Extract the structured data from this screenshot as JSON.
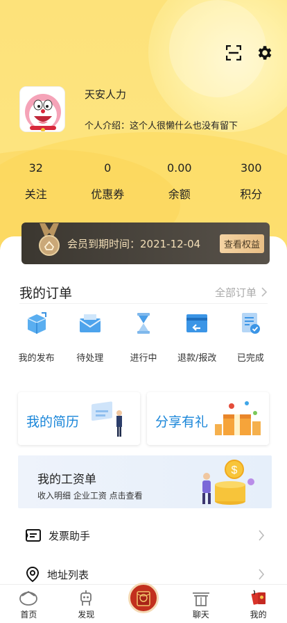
{
  "header": {
    "username": "天安人力",
    "intro": "个人介绍：这个人很懒什么也没有留下"
  },
  "stats": [
    {
      "value": "32",
      "label": "关注"
    },
    {
      "value": "0",
      "label": "优惠券"
    },
    {
      "value": "0.00",
      "label": "余额"
    },
    {
      "value": "300",
      "label": "积分"
    }
  ],
  "vip": {
    "expire_text": "会员到期时间：2021-12-04",
    "button_label": "查看权益"
  },
  "orders": {
    "title": "我的订单",
    "all_label": "全部订单",
    "items": [
      {
        "label": "我的发布",
        "icon": "publish-box-icon"
      },
      {
        "label": "待处理",
        "icon": "mail-icon"
      },
      {
        "label": "进行中",
        "icon": "hourglass-icon"
      },
      {
        "label": "退款/报改",
        "icon": "refund-icon"
      },
      {
        "label": "已完成",
        "icon": "done-doc-icon"
      }
    ]
  },
  "cards": {
    "resume": "我的简历",
    "share": "分享有礼"
  },
  "salary": {
    "title": "我的工资单",
    "subtitle": "收入明细 企业工资 点击查看"
  },
  "menu": {
    "invoice": "发票助手",
    "address": "地址列表"
  },
  "tabbar": [
    {
      "label": "首页"
    },
    {
      "label": "发现"
    },
    {
      "label": ""
    },
    {
      "label": "聊天"
    },
    {
      "label": "我的"
    }
  ],
  "colors": {
    "accent_blue": "#1a86d9",
    "header_yellow": "#fde27a",
    "vip_dark": "#3b3730",
    "vip_gold": "#f3dfb8"
  }
}
